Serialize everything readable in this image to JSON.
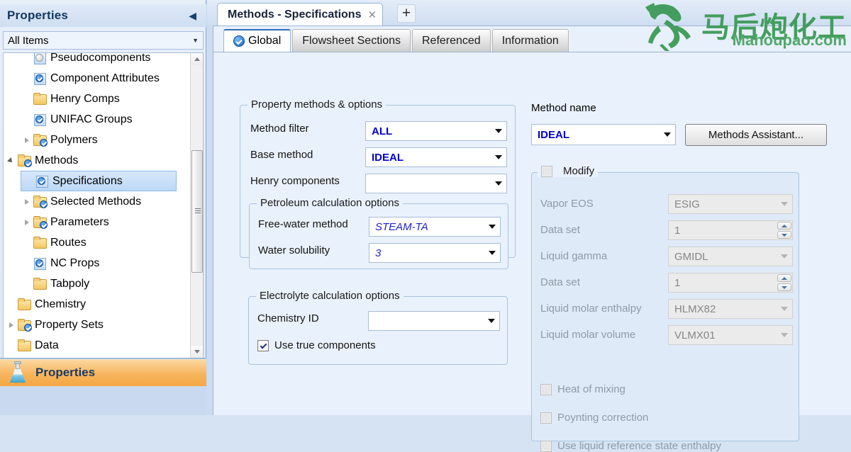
{
  "left_panel": {
    "title": "Properties",
    "collapse_icon": "chevron-left-icon",
    "filter": {
      "value": "All Items",
      "caret": "▾"
    },
    "tree": [
      {
        "label": "Pseudocomponents",
        "icon": "form-grey-icon",
        "indent": 1,
        "expander": "none",
        "selected": false
      },
      {
        "label": "Component Attributes",
        "icon": "form-check-icon",
        "indent": 1,
        "expander": "none",
        "selected": false
      },
      {
        "label": "Henry Comps",
        "icon": "folder-icon",
        "indent": 1,
        "expander": "none",
        "selected": false
      },
      {
        "label": "UNIFAC Groups",
        "icon": "form-check-icon",
        "indent": 1,
        "expander": "none",
        "selected": false
      },
      {
        "label": "Polymers",
        "icon": "folder-check-icon",
        "indent": 1,
        "expander": "closed",
        "selected": false
      },
      {
        "label": "Methods",
        "icon": "folder-check-icon",
        "indent": 0,
        "expander": "open",
        "selected": false
      },
      {
        "label": "Specifications",
        "icon": "form-check-icon",
        "indent": 1,
        "expander": "none",
        "selected": true
      },
      {
        "label": "Selected Methods",
        "icon": "folder-check-icon",
        "indent": 1,
        "expander": "closed",
        "selected": false
      },
      {
        "label": "Parameters",
        "icon": "folder-check-icon",
        "indent": 1,
        "expander": "closed",
        "selected": false
      },
      {
        "label": "Routes",
        "icon": "folder-icon",
        "indent": 1,
        "expander": "none",
        "selected": false
      },
      {
        "label": "NC Props",
        "icon": "form-check-icon",
        "indent": 1,
        "expander": "none",
        "selected": false
      },
      {
        "label": "Tabpoly",
        "icon": "folder-icon",
        "indent": 1,
        "expander": "none",
        "selected": false
      },
      {
        "label": "Chemistry",
        "icon": "folder-icon",
        "indent": 0,
        "expander": "none",
        "selected": false
      },
      {
        "label": "Property Sets",
        "icon": "folder-check-icon",
        "indent": 0,
        "expander": "closed",
        "selected": false
      },
      {
        "label": "Data",
        "icon": "folder-icon",
        "indent": 0,
        "expander": "none",
        "selected": false
      }
    ],
    "nav_button": {
      "label": "Properties",
      "icon": "flask-icon"
    }
  },
  "document_tabs": {
    "active": {
      "label": "Methods - Specifications",
      "close_icon": "close-icon"
    },
    "new_tab_icon": "plus-icon"
  },
  "sub_tabs": [
    {
      "label": "Global",
      "icon": "blue-check-icon",
      "active": true
    },
    {
      "label": "Flowsheet Sections",
      "icon": "",
      "active": false
    },
    {
      "label": "Referenced",
      "icon": "",
      "active": false
    },
    {
      "label": "Information",
      "icon": "",
      "active": false
    }
  ],
  "property_methods": {
    "title": "Property methods & options",
    "method_filter": {
      "label": "Method filter",
      "value": "ALL"
    },
    "base_method": {
      "label": "Base method",
      "value": "IDEAL"
    },
    "henry_components": {
      "label": "Henry components",
      "value": ""
    }
  },
  "petroleum": {
    "title": "Petroleum calculation options",
    "free_water_method": {
      "label": "Free-water method",
      "value": "STEAM-TA"
    },
    "water_solubility": {
      "label": "Water solubility",
      "value": "3"
    }
  },
  "electrolyte": {
    "title": "Electrolyte calculation options",
    "chemistry_id": {
      "label": "Chemistry ID",
      "value": ""
    },
    "use_true_components": {
      "label": "Use true components",
      "checked": true
    }
  },
  "method_name": {
    "label": "Method name",
    "value": "IDEAL",
    "assistant_button": "Methods Assistant..."
  },
  "modify": {
    "title": "Modify",
    "checked": false,
    "fields": [
      {
        "label": "Vapor EOS",
        "value": "ESIG",
        "type": "combo"
      },
      {
        "label": "Data set",
        "value": "1",
        "type": "spin"
      },
      {
        "label": "Liquid gamma",
        "value": "GMIDL",
        "type": "combo"
      },
      {
        "label": "Data set",
        "value": "1",
        "type": "spin"
      },
      {
        "label": "Liquid molar enthalpy",
        "value": "HLMX82",
        "type": "combo"
      },
      {
        "label": "Liquid molar volume",
        "value": "VLMX01",
        "type": "combo"
      }
    ],
    "checkboxes": [
      {
        "label": "Heat of mixing",
        "checked": false
      },
      {
        "label": "Poynting correction",
        "checked": false
      },
      {
        "label": "Use liquid reference state enthalpy",
        "checked": false
      }
    ]
  },
  "watermark": {
    "chinese": "马后炮化工",
    "site": "Mahoupao.com",
    "color": "#3c9a56",
    "icon": "running-horse-icon"
  },
  "colors": {
    "accent_blue": "#0000cd",
    "panel_bg": "#e9f1fc",
    "chrome_blue": "#cfdef2",
    "nav_orange": "#f7b55e",
    "selected_tree": "#bcd8f6"
  }
}
